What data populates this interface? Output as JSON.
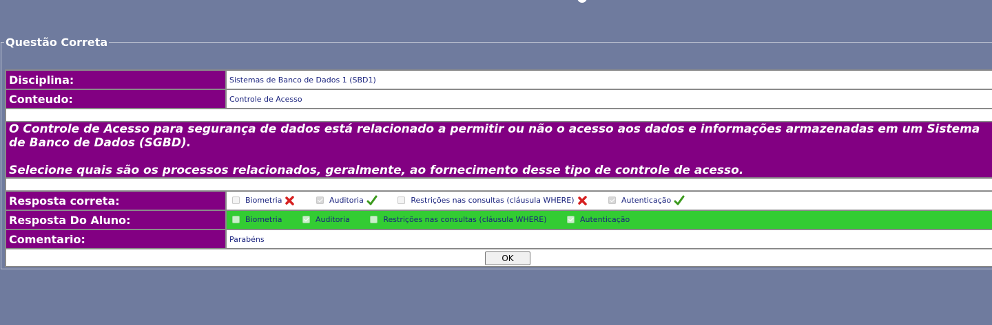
{
  "legend": "Questão Correta",
  "rows": {
    "disciplina": {
      "label": "Disciplina:",
      "value": "Sistemas de Banco de Dados 1 (SBD1)"
    },
    "conteudo": {
      "label": "Conteudo:",
      "value": "Controle de Acesso"
    }
  },
  "question": {
    "line1": "O Controle de Acesso para segurança de dados está relacionado a permitir ou não o acesso aos dados e informações armazenadas em um Sistema",
    "line2": "de Banco de Dados (SGBD).",
    "line3": "Selecione quais são os processos relacionados, geralmente, ao fornecimento desse tipo de controle de acesso."
  },
  "correct": {
    "label": "Resposta correta:",
    "options": [
      {
        "text": "Biometria",
        "checked": false,
        "mark": "cross-icon"
      },
      {
        "text": "Auditoria",
        "checked": true,
        "mark": "check-icon"
      },
      {
        "text": "Restrições nas consultas (cláusula WHERE)",
        "checked": false,
        "mark": "cross-icon"
      },
      {
        "text": "Autenticação",
        "checked": true,
        "mark": "check-icon"
      }
    ]
  },
  "student": {
    "label": "Resposta Do Aluno:",
    "options": [
      {
        "text": "Biometria",
        "checked": false
      },
      {
        "text": "Auditoria",
        "checked": true
      },
      {
        "text": "Restrições nas consultas (cláusula WHERE)",
        "checked": false
      },
      {
        "text": "Autenticação",
        "checked": true
      }
    ]
  },
  "comment": {
    "label": "Comentario:",
    "value": "Parabéns"
  },
  "ok_label": "OK",
  "colors": {
    "background": "#6f7b9e",
    "label_bg": "#820082",
    "correct_bg": "#33cc33",
    "check": "#3c9a1e",
    "cross": "#d62020"
  }
}
